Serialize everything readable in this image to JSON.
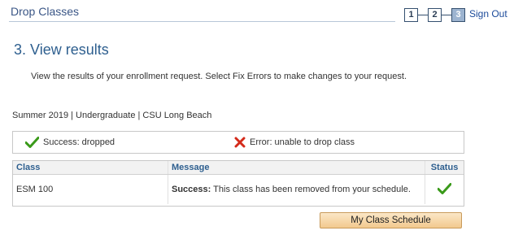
{
  "page": {
    "title": "Drop Classes"
  },
  "steps": [
    "1",
    "2",
    "3"
  ],
  "current_step": "3",
  "sign_out_label": "Sign Out",
  "heading": "3.  View results",
  "instructions": "View the results of your enrollment request.  Select Fix Errors to make changes to your request.",
  "term": "Summer 2019 | Undergraduate | CSU Long Beach",
  "legend": {
    "success_label": "Success: dropped",
    "error_label": "Error: unable to drop class",
    "success_icon": "check-icon",
    "error_icon": "x-icon",
    "success_color": "#3a9a1a",
    "error_color": "#d42a1a"
  },
  "results": {
    "headers": {
      "class": "Class",
      "message": "Message",
      "status": "Status"
    },
    "rows": [
      {
        "class": "ESM  100",
        "message_bold": "Success:",
        "message_text": "This class has been removed from your schedule.",
        "status_icon": "check-icon"
      }
    ]
  },
  "button": {
    "label": "My Class Schedule"
  }
}
